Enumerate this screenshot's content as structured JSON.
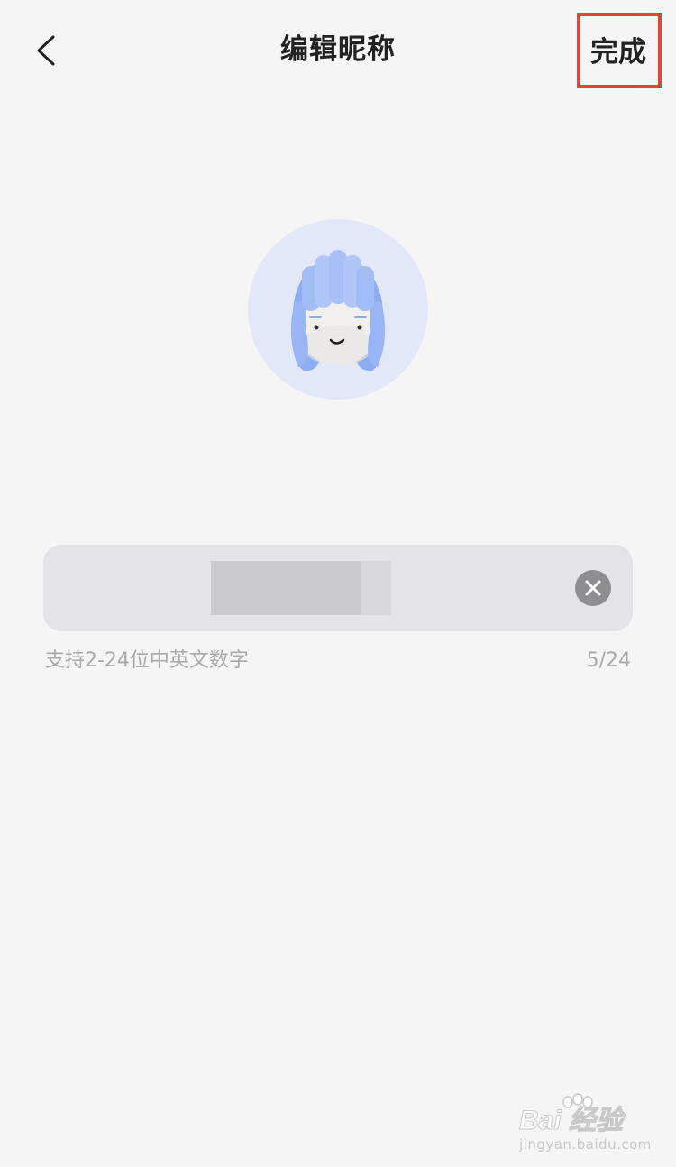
{
  "header": {
    "title": "编辑昵称",
    "done_label": "完成",
    "highlight_color": "#e8413a"
  },
  "avatar": {
    "background": "#e2e8f8",
    "hair_color": "#8eacf2"
  },
  "nickname_input": {
    "value": "",
    "clear_icon": "clear-icon"
  },
  "hint": {
    "text": "支持2-24位中英文数字",
    "counter": "5/24"
  },
  "watermark": {
    "logo": "Bai 经验",
    "url": "jingyan.baidu.com"
  }
}
